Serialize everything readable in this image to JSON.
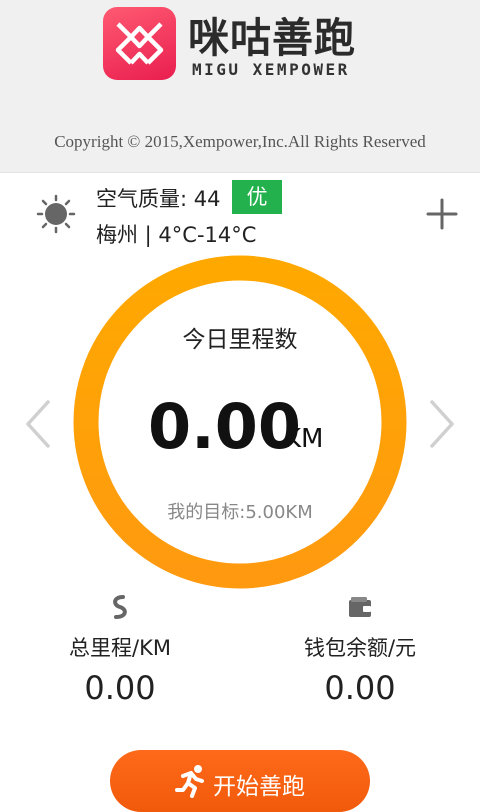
{
  "header": {
    "brand_cn": "咪咕善跑",
    "brand_en": "MIGU XEMPOWER",
    "copyright": "Copyright © 2015,Xempower,Inc.All Rights Reserved"
  },
  "weather": {
    "air_quality_label": "空气质量: 44",
    "air_quality_level": "优",
    "city_temp": "梅州 | 4°C-14°C",
    "icon": "sun-icon",
    "badge_color": "#22b14c"
  },
  "today": {
    "title": "今日里程数",
    "distance": "0.00",
    "unit": "KM",
    "goal": "我的目标:5.00KM",
    "progress": 0,
    "ring_color": "#ffa300"
  },
  "stats": {
    "total_label": "总里程/KM",
    "total_value": "0.00",
    "total_icon": "route-icon",
    "wallet_label": "钱包余额/元",
    "wallet_value": "0.00",
    "wallet_icon": "wallet-icon"
  },
  "actions": {
    "start_label": "开始善跑",
    "start_icon": "runner-icon",
    "accent": "#f5600f"
  }
}
